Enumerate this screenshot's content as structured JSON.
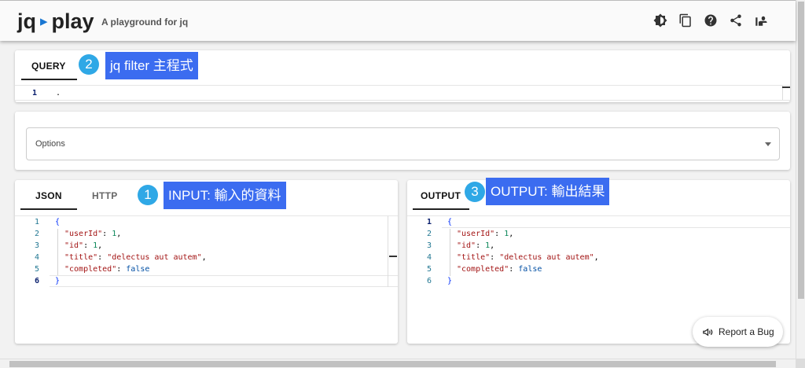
{
  "header": {
    "logo_left": "jq",
    "logo_arrow": "▸",
    "logo_right": "play",
    "tagline": "A playground for jq",
    "icons": [
      "theme-icon",
      "copy-icon",
      "help-icon",
      "share-icon",
      "community-icon"
    ]
  },
  "query": {
    "tab": "QUERY",
    "line_number": "1",
    "code": ".",
    "annotation_number": "2",
    "annotation": "jq filter 主程式"
  },
  "options": {
    "label": "Options"
  },
  "input": {
    "tabs": [
      "JSON",
      "HTTP"
    ],
    "annotation_number": "1",
    "annotation": "INPUT: 輸入的資料",
    "line_numbers": [
      "1",
      "2",
      "3",
      "4",
      "5",
      "6"
    ]
  },
  "output": {
    "tab": "OUTPUT",
    "annotation_number": "3",
    "annotation": "OUTPUT: 輸出結果",
    "line_numbers": [
      "1",
      "2",
      "3",
      "4",
      "5",
      "6"
    ]
  },
  "json_lines": {
    "open": "{",
    "close": "}",
    "fields": [
      {
        "key": "\"userId\"",
        "value": "1",
        "sep": ","
      },
      {
        "key": "\"id\"",
        "value": "1",
        "sep": ","
      },
      {
        "key": "\"title\"",
        "value": "\"delectus aut autem\"",
        "sep": ","
      },
      {
        "key": "\"completed\"",
        "value": "false",
        "sep": ""
      }
    ]
  },
  "report_bug": {
    "label": "Report a Bug"
  },
  "colors": {
    "accent": "#1976d2",
    "annotation_bg": "#3b6cf0",
    "badge_bg": "#2fa8e6"
  }
}
